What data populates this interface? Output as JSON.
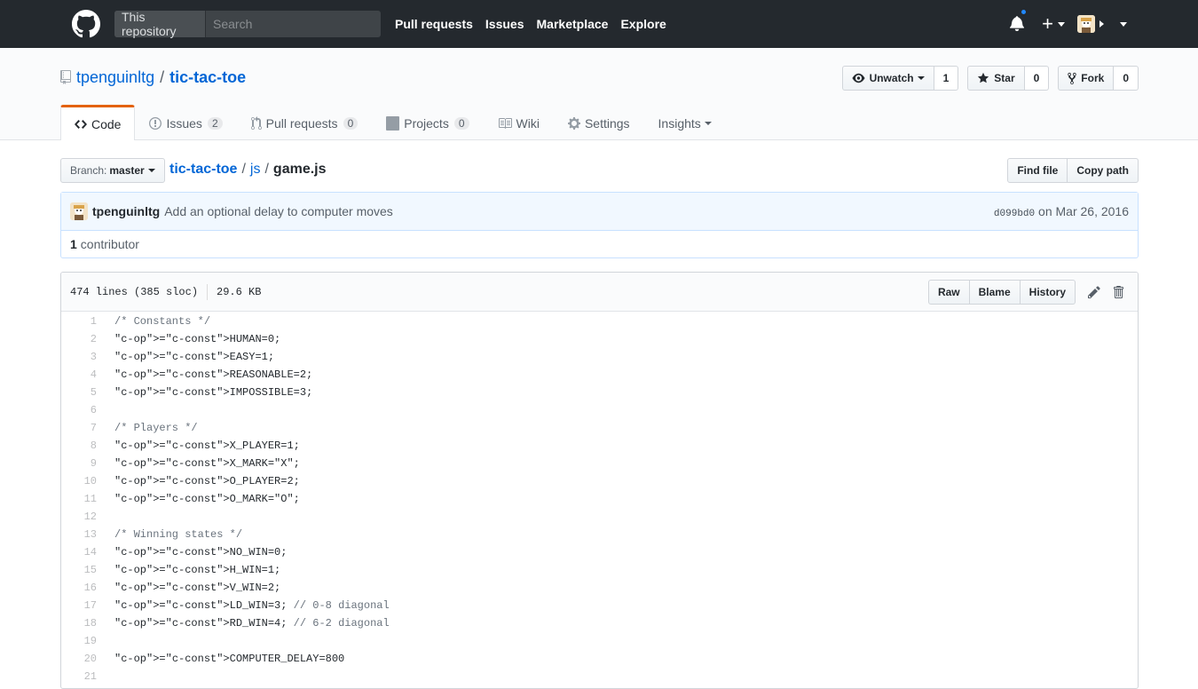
{
  "header": {
    "search_scope": "This repository",
    "search_placeholder": "Search",
    "nav": [
      "Pull requests",
      "Issues",
      "Marketplace",
      "Explore"
    ]
  },
  "repo": {
    "owner": "tpenguinltg",
    "separator": "/",
    "name": "tic-tac-toe",
    "watch_label": "Unwatch",
    "watch_count": "1",
    "star_label": "Star",
    "star_count": "0",
    "fork_label": "Fork",
    "fork_count": "0"
  },
  "reponav": {
    "code": "Code",
    "issues": "Issues",
    "issues_count": "2",
    "pulls": "Pull requests",
    "pulls_count": "0",
    "projects": "Projects",
    "projects_count": "0",
    "wiki": "Wiki",
    "settings": "Settings",
    "insights": "Insights"
  },
  "file_nav": {
    "branch_label": "Branch:",
    "branch_value": "master",
    "crumb_repo": "tic-tac-toe",
    "crumb_dir": "js",
    "crumb_file": "game.js",
    "find_file": "Find file",
    "copy_path": "Copy path"
  },
  "commit": {
    "author": "tpenguinltg",
    "message": "Add an optional delay to computer moves",
    "sha": "d099bd0",
    "date": "on Mar 26, 2016",
    "contributors_count": "1",
    "contributors_label": "contributor"
  },
  "file": {
    "lines_info": "474 lines (385 sloc)",
    "size": "29.6 KB",
    "raw": "Raw",
    "blame": "Blame",
    "history": "History"
  },
  "code_lines": [
    {
      "n": "1",
      "t": "/* Constants */"
    },
    {
      "n": "2",
      "t": "HUMAN=0;"
    },
    {
      "n": "3",
      "t": "EASY=1;"
    },
    {
      "n": "4",
      "t": "REASONABLE=2;"
    },
    {
      "n": "5",
      "t": "IMPOSSIBLE=3;"
    },
    {
      "n": "6",
      "t": ""
    },
    {
      "n": "7",
      "t": "/* Players */"
    },
    {
      "n": "8",
      "t": "X_PLAYER=1;"
    },
    {
      "n": "9",
      "t": "X_MARK=\"X\";"
    },
    {
      "n": "10",
      "t": "O_PLAYER=2;"
    },
    {
      "n": "11",
      "t": "O_MARK=\"O\";"
    },
    {
      "n": "12",
      "t": ""
    },
    {
      "n": "13",
      "t": "/* Winning states */"
    },
    {
      "n": "14",
      "t": "NO_WIN=0;"
    },
    {
      "n": "15",
      "t": "H_WIN=1;"
    },
    {
      "n": "16",
      "t": "V_WIN=2;"
    },
    {
      "n": "17",
      "t": "LD_WIN=3; // 0-8 diagonal"
    },
    {
      "n": "18",
      "t": "RD_WIN=4; // 6-2 diagonal"
    },
    {
      "n": "19",
      "t": ""
    },
    {
      "n": "20",
      "t": "COMPUTER_DELAY=800"
    },
    {
      "n": "21",
      "t": ""
    }
  ],
  "colors": {
    "header_bg": "#24292e",
    "link": "#0366d6",
    "tab_accent": "#e36209",
    "notification_dot": "#2188ff"
  }
}
